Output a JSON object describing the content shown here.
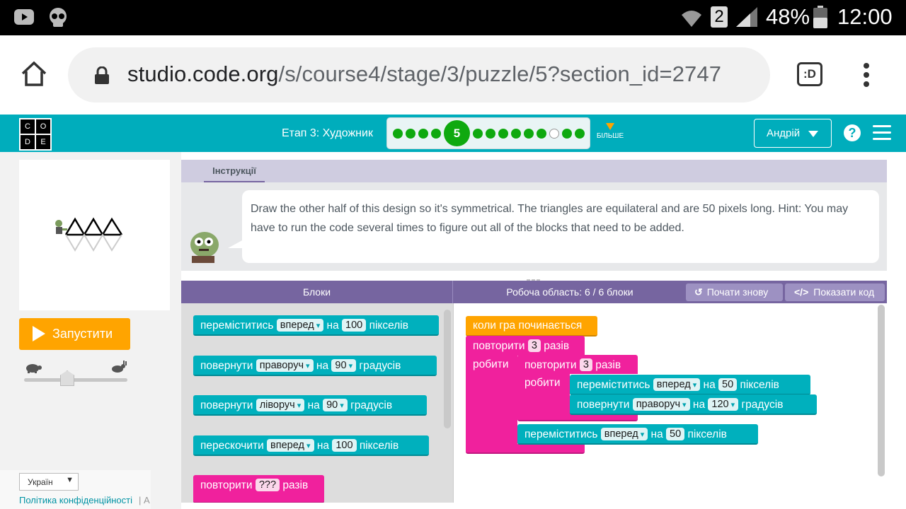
{
  "statusbar": {
    "battery": "48%",
    "time": "12:00",
    "sim": "2"
  },
  "browser": {
    "url_host": "studio.code.org",
    "url_path": "/s/course4/stage/3/puzzle/5?section_id=2747"
  },
  "header": {
    "logo_letters": [
      "C",
      "O",
      "D",
      "E"
    ],
    "stage_label": "Етап 3: Художник",
    "current_puzzle": "5",
    "more_label": "БІЛЬШЕ",
    "user_label": "Андрій",
    "help_label": "?"
  },
  "left": {
    "run_label": "Запустити",
    "language": "Україн",
    "privacy": "Політика конфіденційності",
    "footer_trail": "| А"
  },
  "instructions": {
    "tab_label": "Інструкції",
    "text": "Draw the other half of this design so it's symmetrical. The triangles are equilateral and are 50 pixels long. Hint: You may have to run the code several times to figure out all of the blocks that need to be added."
  },
  "workspace": {
    "toolbox_title": "Блоки",
    "work_title": "Робоча область: 6 / 6 блоки",
    "restart_label": "Почати знову",
    "show_code_label": "Показати код"
  },
  "toolbox_blocks": [
    {
      "verb": "переміститись",
      "opt": "вперед",
      "mid": "на",
      "num": "100",
      "unit": "пікселів"
    },
    {
      "verb": "повернути",
      "opt": "праворуч",
      "mid": "на",
      "num": "90",
      "unit": "градусів"
    },
    {
      "verb": "повернути",
      "opt": "ліворуч",
      "mid": "на",
      "num": "90",
      "unit": "градусів"
    },
    {
      "verb": "перескочити",
      "opt": "вперед",
      "mid": "на",
      "num": "100",
      "unit": "пікселів"
    },
    {
      "verb": "повторити",
      "num": "???",
      "unit": "разів"
    }
  ],
  "program": {
    "start": "коли гра починається",
    "repeat_outer": {
      "verb": "повторити",
      "num": "3",
      "unit": "разів",
      "do": "робити"
    },
    "repeat_inner": {
      "verb": "повторити",
      "num": "3",
      "unit": "разів",
      "do": "робити"
    },
    "move1": {
      "verb": "переміститись",
      "opt": "вперед",
      "mid": "на",
      "num": "50",
      "unit": "пікселів"
    },
    "turn1": {
      "verb": "повернути",
      "opt": "праворуч",
      "mid": "на",
      "num": "120",
      "unit": "градусів"
    },
    "move2": {
      "verb": "переміститись",
      "opt": "вперед",
      "mid": "на",
      "num": "50",
      "unit": "пікселів"
    }
  },
  "colors": {
    "header_teal": "#00adbc",
    "run_orange": "#ffa400",
    "block_teal": "#00b0bd",
    "block_pink": "#f0219d",
    "workspace_purple": "#7665a0"
  }
}
